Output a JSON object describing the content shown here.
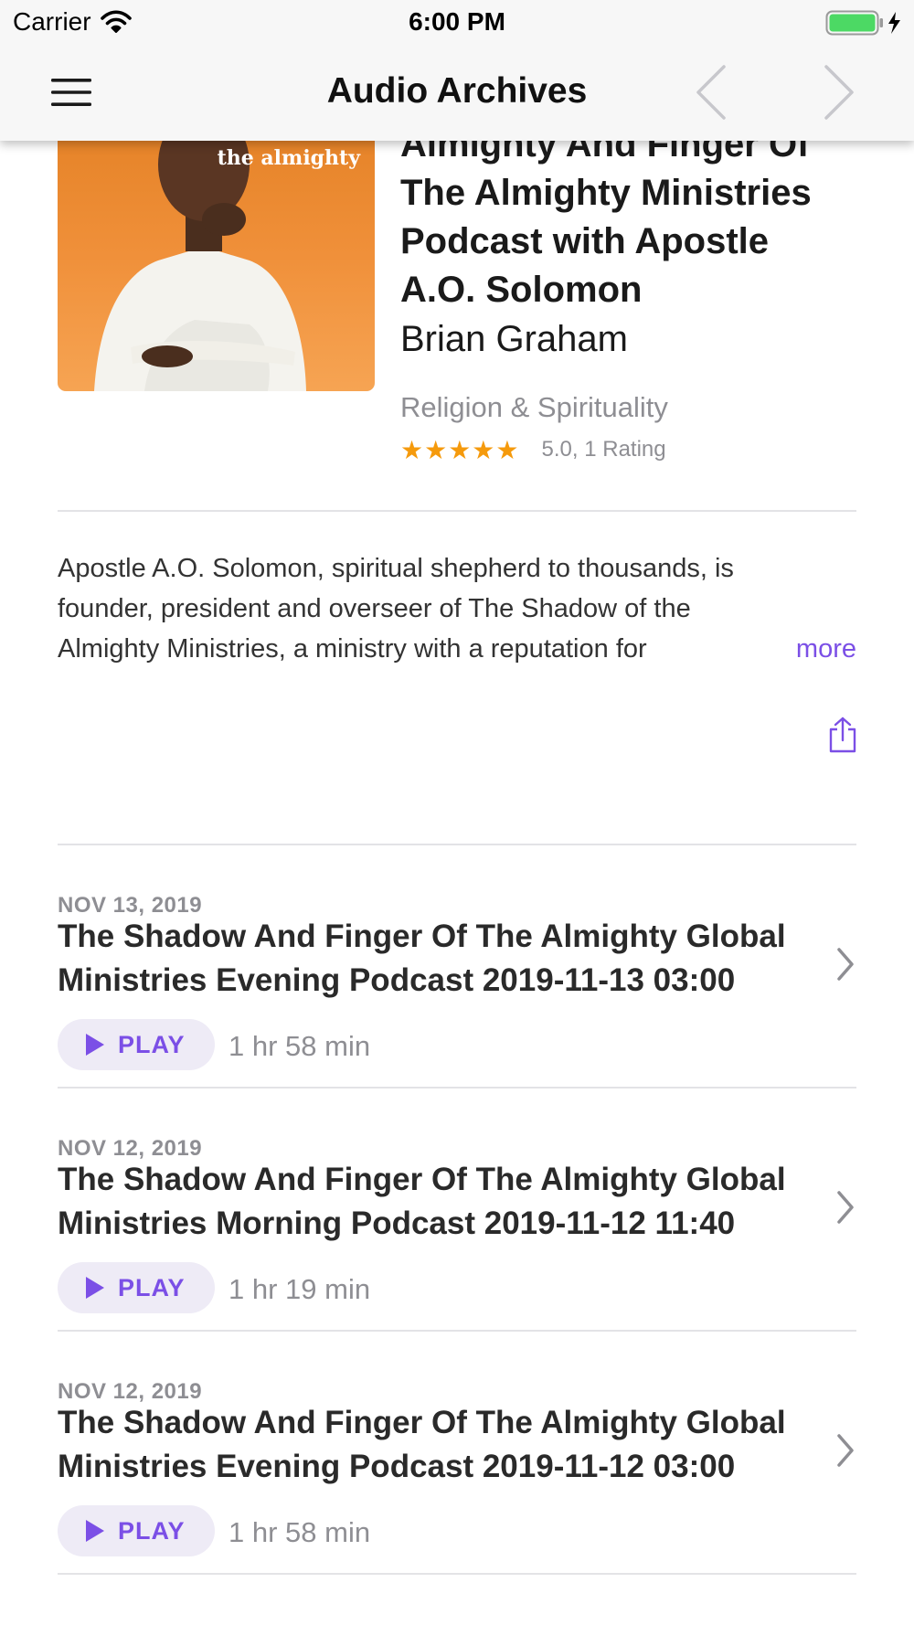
{
  "status_bar": {
    "carrier": "Carrier",
    "time": "6:00 PM"
  },
  "nav": {
    "title": "Audio Archives",
    "menu_icon": "hamburger-menu-icon",
    "back_icon": "chevron-left-icon",
    "forward_icon": "chevron-right-icon"
  },
  "podcast": {
    "artwork_text": "the almighty",
    "title_lines": [
      "Almighty And Finger Of",
      "The Almighty Ministries",
      "Podcast with Apostle",
      "A.O. Solomon"
    ],
    "author": "Brian Graham",
    "category": "Religion & Spirituality",
    "stars": "★★★★★",
    "rating_value": 5.0,
    "rating_text": "5.0, 1 Rating",
    "description_lines": [
      "Apostle A.O. Solomon, spiritual shepherd to thousands, is",
      "founder, president and overseer of The Shadow of the",
      "Almighty Ministries, a ministry with a reputation for"
    ],
    "more_label": "more",
    "share_icon": "share-icon"
  },
  "episodes": [
    {
      "date": "NOV 13, 2019",
      "title_lines": [
        "The Shadow And Finger Of The Almighty Global",
        "Ministries Evening Podcast 2019-11-13 03:00"
      ],
      "play_label": "PLAY",
      "duration": "1 hr 58 min"
    },
    {
      "date": "NOV 12, 2019",
      "title_lines": [
        "The Shadow And Finger Of The Almighty Global",
        "Ministries Morning Podcast 2019-11-12 11:40"
      ],
      "play_label": "PLAY",
      "duration": "1 hr 19 min"
    },
    {
      "date": "NOV 12, 2019",
      "title_lines": [
        "The Shadow And Finger Of The Almighty Global",
        "Ministries Evening Podcast 2019-11-12 03:00"
      ],
      "play_label": "PLAY",
      "duration": "1 hr 58 min"
    }
  ],
  "colors": {
    "accent": "#7b4fe6",
    "star": "#f59a0c",
    "secondary_text": "#8e8e93",
    "battery": "#4cd964"
  }
}
